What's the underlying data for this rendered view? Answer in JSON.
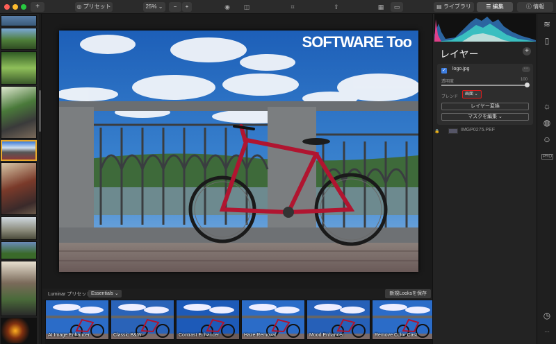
{
  "toolbar": {
    "add_label": "+",
    "presets_label": "プリセット",
    "zoom_label": "25%",
    "zoom_minus": "−",
    "zoom_plus": "+",
    "tab_library": "ライブラリ",
    "tab_edit": "編集",
    "tab_info": "情報",
    "colors": {
      "close": "#ff5f57",
      "minimize": "#febc2e",
      "maximize": "#28c840"
    }
  },
  "photo": {
    "logo_text": "SOFTWARE Too"
  },
  "presets_bar": {
    "label": "Luminar プリセット",
    "category": "Essentials",
    "save_label": "新規Looksを保存",
    "items": [
      {
        "name": "AI Image Enhancer"
      },
      {
        "name": "Classic B&W"
      },
      {
        "name": "Contrast Enhancer"
      },
      {
        "name": "Haze Removal"
      },
      {
        "name": "Mood Enhancer"
      },
      {
        "name": "Remove Color Cast"
      }
    ]
  },
  "layers": {
    "title": "レイヤー",
    "add_label": "+",
    "layer": {
      "check": "✓",
      "name": "logo.jpg",
      "more": "···",
      "opacity_label": "透明度",
      "opacity_value": "100",
      "opacity_fraction": 1.0,
      "blend_label": "ブレンド",
      "blend_value": "画面",
      "transform_label": "レイヤー変換",
      "mask_label": "マスクを編集"
    },
    "base_layer_name": "IMGP0275.PEF"
  },
  "icons": {
    "layers": "layers-icon",
    "sun": "sun-icon",
    "palette": "palette-icon",
    "face": "face-icon",
    "pro_label": "PRO",
    "history": "history-icon",
    "more": "···"
  }
}
